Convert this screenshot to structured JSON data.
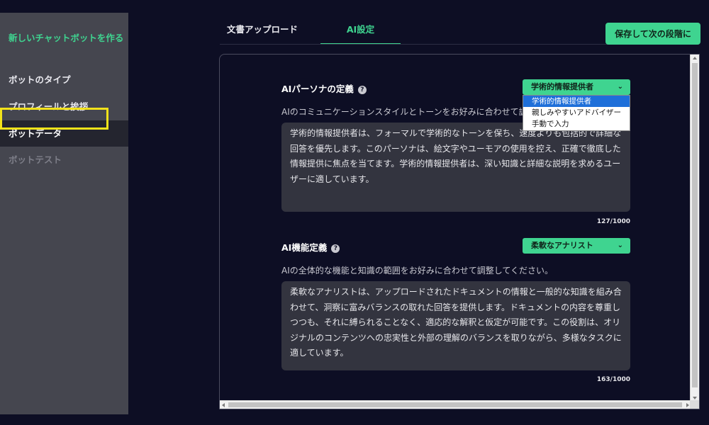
{
  "sidebar": {
    "title": "新しいチャットボットを作る",
    "items": [
      {
        "label": "ボットのタイプ",
        "state": "normal"
      },
      {
        "label": "プロフィールと挨拶",
        "state": "normal"
      },
      {
        "label": "ボットデータ",
        "state": "active"
      },
      {
        "label": "ボットテスト",
        "state": "disabled"
      }
    ]
  },
  "tabs": [
    {
      "label": "文書アップロード",
      "active": false
    },
    {
      "label": "AI設定",
      "active": true
    }
  ],
  "save_button": "保存して次の段階に",
  "persona": {
    "title": "AIパーソナの定義",
    "help_icon": "?",
    "selected": "学術的情報提供者",
    "options": [
      "学術的情報提供者",
      "親しみやすいアドバイザー",
      "手動で入力"
    ],
    "description": "AIのコミュニケーションスタイルとトーンをお好みに合わせて調",
    "text": "学術的情報提供者は、フォーマルで学術的なトーンを保ち、速度よりも包括的で詳細な回答を優先します。このパーソナは、絵文字やユーモアの使用を控え、正確で徹底した情報提供に焦点を当てます。学術的情報提供者は、深い知識と詳細な説明を求めるユーザーに適しています。",
    "count": "127/1000"
  },
  "function": {
    "title": "AI機能定義",
    "help_icon": "?",
    "selected": "柔軟なアナリスト",
    "description": "AIの全体的な機能と知識の範囲をお好みに合わせて調整してください。",
    "text": "柔軟なアナリストは、アップロードされたドキュメントの情報と一般的な知識を組み合わせて、洞察に富みバランスの取れた回答を提供します。ドキュメントの内容を尊重しつつも、それに縛られることなく、適応的な解釈と仮定が可能です。この役割は、オリジナルのコンテンツへの忠実性と外部の理解のバランスを取りながら、多様なタスクに適しています。",
    "count": "163/1000"
  },
  "colors": {
    "accent": "#3fd490",
    "background": "#0d0e24",
    "sidebar": "#45464f",
    "highlight": "#f2e21a"
  }
}
